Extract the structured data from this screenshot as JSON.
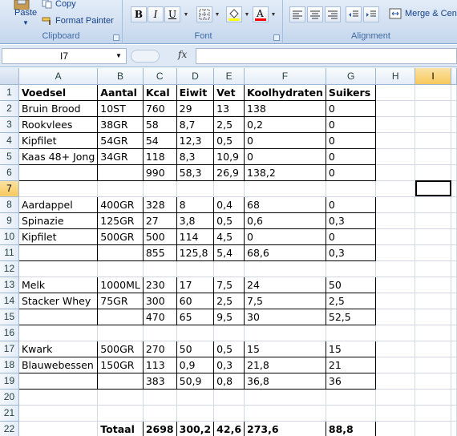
{
  "ribbon": {
    "clipboard": {
      "paste_label": "Paste",
      "copy_label": "Copy",
      "format_painter_label": "Format Painter",
      "group_label": "Clipboard"
    },
    "font": {
      "bold_label": "B",
      "italic_label": "I",
      "underline_label": "U",
      "group_label": "Font",
      "font_color": "#ff0000",
      "fill_color": "#ffff00"
    },
    "alignment": {
      "merge_label": "Merge & Cen",
      "group_label": "Alignment"
    }
  },
  "formula_bar": {
    "name_box": "I7",
    "fx_label": "fx",
    "formula": ""
  },
  "columns": [
    "A",
    "B",
    "C",
    "D",
    "E",
    "F",
    "G",
    "H",
    "I"
  ],
  "active_column": "I",
  "active_row": "7",
  "rows": [
    {
      "n": "1",
      "cells": [
        "Voedsel",
        "Aantal",
        "Kcal",
        "Eiwit",
        "Vet",
        "Koolhydraten",
        "Suikers",
        "",
        ""
      ]
    },
    {
      "n": "2",
      "cells": [
        "Bruin Brood",
        "10ST",
        "760",
        "29",
        "13",
        "138",
        "0",
        "",
        ""
      ]
    },
    {
      "n": "3",
      "cells": [
        "Rookvlees",
        "38GR",
        "58",
        "8,7",
        "2,5",
        "0,2",
        "0",
        "",
        ""
      ]
    },
    {
      "n": "4",
      "cells": [
        "Kipfilet",
        "54GR",
        "54",
        "12,3",
        "0,5",
        "0",
        "0",
        "",
        ""
      ]
    },
    {
      "n": "5",
      "cells": [
        "Kaas 48+ Jong",
        "34GR",
        "118",
        "8,3",
        "10,9",
        "0",
        "0",
        "",
        ""
      ]
    },
    {
      "n": "6",
      "cells": [
        "",
        "",
        "990",
        "58,3",
        "26,9",
        "138,2",
        "0",
        "",
        ""
      ]
    },
    {
      "n": "7",
      "cells": [
        "",
        "",
        "",
        "",
        "",
        "",
        "",
        "",
        ""
      ]
    },
    {
      "n": "8",
      "cells": [
        "Aardappel",
        "400GR",
        "328",
        "8",
        "0,4",
        "68",
        "0",
        "",
        ""
      ]
    },
    {
      "n": "9",
      "cells": [
        "Spinazie",
        "125GR",
        "27",
        "3,8",
        "0,5",
        "0,6",
        "0,3",
        "",
        ""
      ]
    },
    {
      "n": "10",
      "cells": [
        "Kipfilet",
        "500GR",
        "500",
        "114",
        "4,5",
        "0",
        "0",
        "",
        ""
      ]
    },
    {
      "n": "11",
      "cells": [
        "",
        "",
        "855",
        "125,8",
        "5,4",
        "68,6",
        "0,3",
        "",
        ""
      ]
    },
    {
      "n": "12",
      "cells": [
        "",
        "",
        "",
        "",
        "",
        "",
        "",
        "",
        ""
      ]
    },
    {
      "n": "13",
      "cells": [
        "Melk",
        "1000ML",
        "230",
        "17",
        "7,5",
        "24",
        "50",
        "",
        ""
      ]
    },
    {
      "n": "14",
      "cells": [
        "Stacker Whey",
        "75GR",
        "300",
        "60",
        "2,5",
        "7,5",
        "2,5",
        "",
        ""
      ]
    },
    {
      "n": "15",
      "cells": [
        "",
        "",
        "470",
        "65",
        "9,5",
        "30",
        "52,5",
        "",
        ""
      ]
    },
    {
      "n": "16",
      "cells": [
        "",
        "",
        "",
        "",
        "",
        "",
        "",
        "",
        ""
      ]
    },
    {
      "n": "17",
      "cells": [
        "Kwark",
        "500GR",
        "270",
        "50",
        "0,5",
        "15",
        "15",
        "",
        ""
      ]
    },
    {
      "n": "18",
      "cells": [
        "Blauwebessen",
        "150GR",
        "113",
        "0,9",
        "0,3",
        "21,8",
        "21",
        "",
        ""
      ]
    },
    {
      "n": "19",
      "cells": [
        "",
        "",
        "383",
        "50,9",
        "0,8",
        "36,8",
        "36",
        "",
        ""
      ]
    },
    {
      "n": "20",
      "cells": [
        "",
        "",
        "",
        "",
        "",
        "",
        "",
        "",
        ""
      ]
    },
    {
      "n": "21",
      "cells": [
        "",
        "",
        "",
        "",
        "",
        "",
        "",
        "",
        ""
      ]
    },
    {
      "n": "22",
      "cells": [
        "",
        "Totaal",
        "2698",
        "300,2",
        "42,6",
        "273,6",
        "88,8",
        "",
        ""
      ]
    }
  ]
}
